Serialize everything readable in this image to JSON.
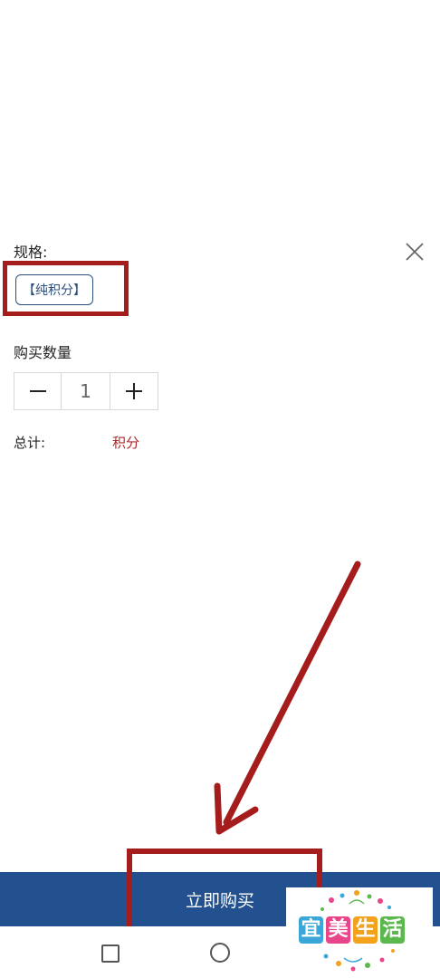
{
  "spec": {
    "label": "规格:",
    "option": "【纯积分】"
  },
  "quantity": {
    "label": "购买数量",
    "value": "1"
  },
  "total": {
    "label": "总计:",
    "value": "积分"
  },
  "buy_button": {
    "label": "立即购买"
  },
  "logo": {
    "chars": [
      "宜",
      "美",
      "生",
      "活"
    ],
    "colors": [
      "#3aa7d8",
      "#e8458b",
      "#f2a21b",
      "#5bb84d"
    ]
  },
  "icons": {
    "close": "close-icon",
    "minus": "minus-icon",
    "plus": "plus-icon",
    "nav_recent": "square-icon",
    "nav_home": "circle-icon"
  },
  "colors": {
    "accent": "#23508f",
    "highlight": "#a51c1c",
    "price": "#b3262a"
  }
}
